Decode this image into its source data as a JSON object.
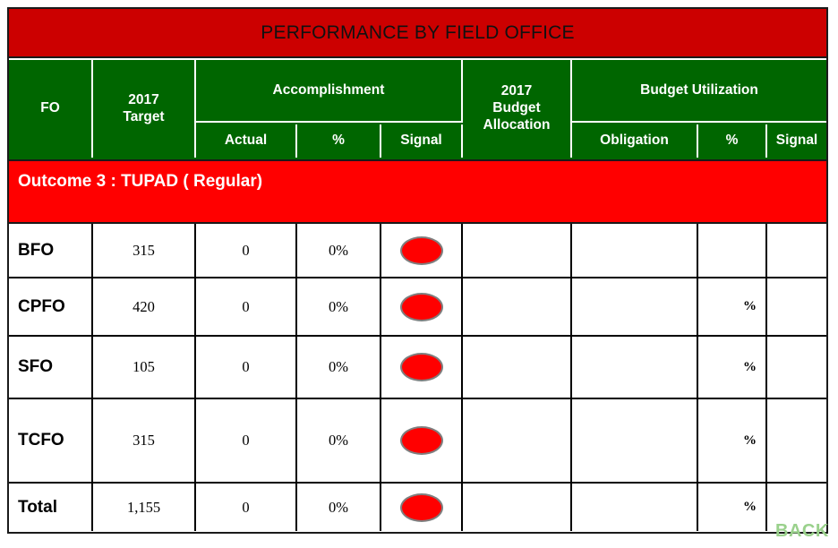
{
  "title": "PERFORMANCE BY FIELD OFFICE",
  "section": "Outcome 3 : TUPAD ( Regular)",
  "header": {
    "fo": "FO",
    "target": "2017\nTarget",
    "target_line1": "2017",
    "target_line2": "Target",
    "accomplishment": "Accomplishment",
    "actual": "Actual",
    "acc_percent": "%",
    "acc_signal": "Signal",
    "budget_allocation_line1": "2017",
    "budget_allocation_line2": "Budget",
    "budget_allocation_line3": "Allocation",
    "budget_utilization": "Budget Utilization",
    "obligation": "Obligation",
    "bu_percent": "%",
    "bu_signal": "Signal"
  },
  "rows": [
    {
      "fo": "BFO",
      "target": "315",
      "actual": "0",
      "acc_percent": "0%",
      "acc_signal": "red",
      "budget_allocation": "",
      "obligation": "",
      "bu_percent": "",
      "bu_signal": ""
    },
    {
      "fo": "CPFO",
      "target": "420",
      "actual": "0",
      "acc_percent": "0%",
      "acc_signal": "red",
      "budget_allocation": "",
      "obligation": "",
      "bu_percent": "%",
      "bu_signal": ""
    },
    {
      "fo": "SFO",
      "target": "105",
      "actual": "0",
      "acc_percent": "0%",
      "acc_signal": "red",
      "budget_allocation": "",
      "obligation": "",
      "bu_percent": "%",
      "bu_signal": ""
    },
    {
      "fo": "TCFO",
      "target": "315",
      "actual": "0",
      "acc_percent": "0%",
      "acc_signal": "red",
      "budget_allocation": "",
      "obligation": "",
      "bu_percent": "%",
      "bu_signal": ""
    },
    {
      "fo": "Total",
      "target": "1,155",
      "actual": "0",
      "acc_percent": "0%",
      "acc_signal": "red",
      "budget_allocation": "",
      "obligation": "",
      "bu_percent": "%",
      "bu_signal": ""
    }
  ],
  "back_label": "BACK",
  "colors": {
    "title_band": "#cc0000",
    "header_band": "#006600",
    "section_band": "#ff0000",
    "signal_red": "#ff0000",
    "signal_border": "#7f7f7f",
    "back_text": "#9ad18c"
  }
}
